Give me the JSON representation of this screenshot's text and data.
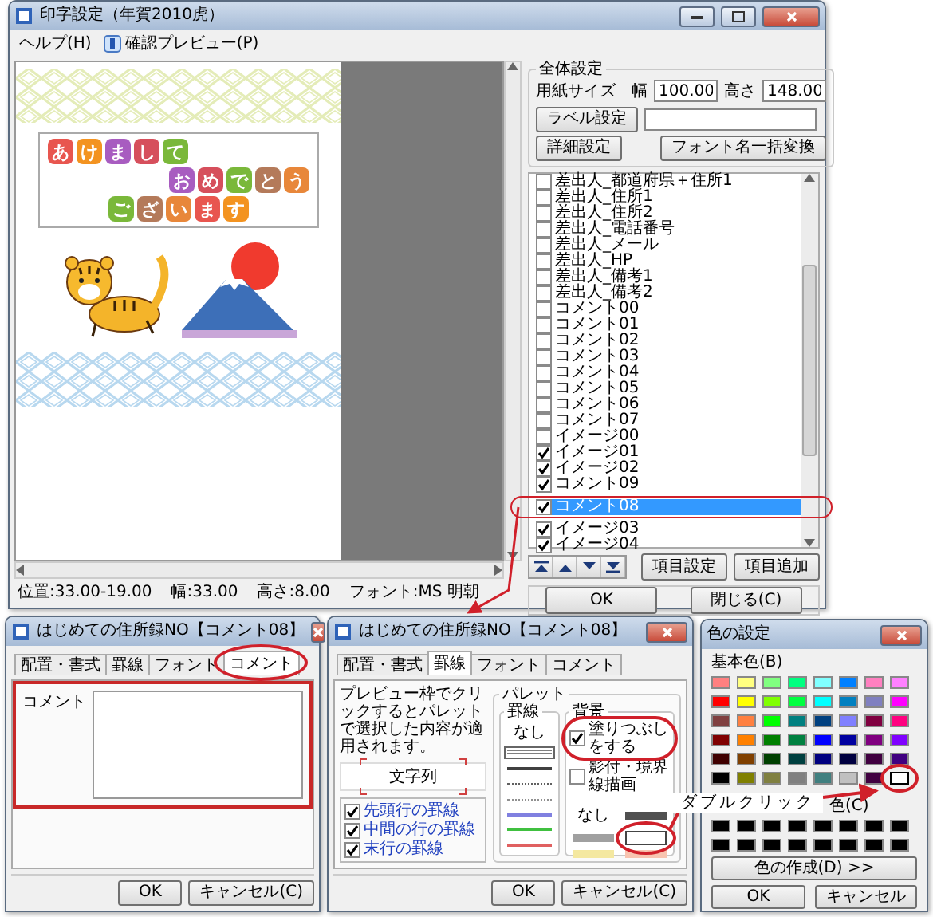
{
  "main_window": {
    "title": "印字設定（年賀2010虎）",
    "menu": [
      {
        "label": "ヘルプ(H)",
        "kind": "plain"
      },
      {
        "label": "確認プレビュー(P)",
        "kind": "icon"
      }
    ],
    "greeting_lines": [
      "あけまして",
      "おめでとう",
      "ございます"
    ],
    "status_bar": [
      "位置:33.00-19.00",
      "幅:33.00",
      "高さ:8.00",
      "フォント:MS 明朝"
    ],
    "settings": {
      "title": "全体設定",
      "paper_size_label": "用紙サイズ",
      "width_label": "幅",
      "width_value": "100.00",
      "height_label": "高さ",
      "height_value": "148.00",
      "label_button": "ラベル設定",
      "detail_button": "詳細設定",
      "font_button": "フォント名一括変換"
    },
    "items": [
      {
        "label": "差出人_都道府県＋住所1",
        "checked": false,
        "selected": false
      },
      {
        "label": "差出人_住所1",
        "checked": false,
        "selected": false
      },
      {
        "label": "差出人_住所2",
        "checked": false,
        "selected": false
      },
      {
        "label": "差出人_電話番号",
        "checked": false,
        "selected": false
      },
      {
        "label": "差出人_メール",
        "checked": false,
        "selected": false
      },
      {
        "label": "差出人_HP",
        "checked": false,
        "selected": false
      },
      {
        "label": "差出人_備考1",
        "checked": false,
        "selected": false
      },
      {
        "label": "差出人_備考2",
        "checked": false,
        "selected": false
      },
      {
        "label": "コメント00",
        "checked": false,
        "selected": false
      },
      {
        "label": "コメント01",
        "checked": false,
        "selected": false
      },
      {
        "label": "コメント02",
        "checked": false,
        "selected": false
      },
      {
        "label": "コメント03",
        "checked": false,
        "selected": false
      },
      {
        "label": "コメント04",
        "checked": false,
        "selected": false
      },
      {
        "label": "コメント05",
        "checked": false,
        "selected": false
      },
      {
        "label": "コメント06",
        "checked": false,
        "selected": false
      },
      {
        "label": "コメント07",
        "checked": false,
        "selected": false
      },
      {
        "label": "イメージ00",
        "checked": false,
        "selected": false
      },
      {
        "label": "イメージ01",
        "checked": true,
        "selected": false
      },
      {
        "label": "イメージ02",
        "checked": true,
        "selected": false
      },
      {
        "label": "コメント09",
        "checked": true,
        "selected": false
      },
      {
        "label": "コメント08",
        "checked": true,
        "selected": true
      },
      {
        "label": "イメージ03",
        "checked": true,
        "selected": false
      },
      {
        "label": "イメージ04",
        "checked": true,
        "selected": false
      }
    ],
    "order_buttons": [
      {
        "kind": "top"
      },
      {
        "kind": "up"
      },
      {
        "kind": "down"
      },
      {
        "kind": "bottom"
      }
    ],
    "item_buttons": [
      "項目設定",
      "項目追加"
    ],
    "footer_buttons": [
      "OK",
      "閉じる(C)"
    ]
  },
  "comment_dialog": {
    "title": "はじめての住所録NO【コメント08】",
    "tabs": [
      {
        "label": "配置・書式",
        "selected": false
      },
      {
        "label": "罫線",
        "selected": false
      },
      {
        "label": "フォント",
        "selected": false
      },
      {
        "label": "コメント",
        "selected": true
      }
    ],
    "comment_label": "コメント",
    "buttons": [
      "OK",
      "キャンセル(C)"
    ]
  },
  "border_dialog": {
    "title": "はじめての住所録NO【コメント08】",
    "tabs": [
      {
        "label": "配置・書式",
        "selected": false
      },
      {
        "label": "罫線",
        "selected": true
      },
      {
        "label": "フォント",
        "selected": false
      },
      {
        "label": "コメント",
        "selected": false
      }
    ],
    "instruction": "プレビュー枠でクリックするとパレットで選択した内容が適用されます。",
    "preview_text": "文字列",
    "line_options": [
      {
        "label": "先頭行の罫線",
        "checked": true
      },
      {
        "label": "中間の行の罫線",
        "checked": true
      },
      {
        "label": "末行の罫線",
        "checked": true
      }
    ],
    "palette_title": "パレット",
    "border_group": {
      "title": "罫線",
      "none_label": "なし",
      "lines": [
        {
          "kind": "double",
          "color": "#808080",
          "selected": true
        },
        {
          "kind": "solid",
          "color": "#404040",
          "selected": false
        },
        {
          "kind": "dotted",
          "color": "#606060",
          "selected": false
        },
        {
          "kind": "dotted",
          "color": "#909090",
          "selected": false
        },
        {
          "kind": "solid",
          "color": "#8080e0",
          "selected": false
        },
        {
          "kind": "solid",
          "color": "#40c040",
          "selected": false
        },
        {
          "kind": "solid",
          "color": "#e06060",
          "selected": false
        }
      ]
    },
    "background_group": {
      "title": "背景",
      "options": [
        {
          "label": "塗りつぶしをする",
          "checked": true
        },
        {
          "label": "影付・境界線描画",
          "checked": false
        }
      ],
      "none_label": "なし",
      "swatches": [
        {
          "color": "#505050",
          "selected": false
        },
        {
          "color": "#a0a0a0",
          "selected": false
        },
        {
          "color": "#ffffff",
          "selected": true
        },
        {
          "color": "#f4e8a0",
          "selected": false
        },
        {
          "color": "#f8c4b0",
          "selected": false
        }
      ]
    },
    "buttons": [
      "OK",
      "キャンセル(C)"
    ]
  },
  "callout": "ダブルクリック",
  "color_dialog": {
    "title": "色の設定",
    "basic_label": "基本色(B)",
    "basic_colors": [
      {
        "color": "#ff8080",
        "selected": false
      },
      {
        "color": "#ffff80",
        "selected": false
      },
      {
        "color": "#80ff80",
        "selected": false
      },
      {
        "color": "#00ff80",
        "selected": false
      },
      {
        "color": "#80ffff",
        "selected": false
      },
      {
        "color": "#0080ff",
        "selected": false
      },
      {
        "color": "#ff80c0",
        "selected": false
      },
      {
        "color": "#ff80ff",
        "selected": false
      },
      {
        "color": "#ff0000",
        "selected": false
      },
      {
        "color": "#ffff00",
        "selected": false
      },
      {
        "color": "#80ff00",
        "selected": false
      },
      {
        "color": "#00ff40",
        "selected": false
      },
      {
        "color": "#00ffff",
        "selected": false
      },
      {
        "color": "#0080c0",
        "selected": false
      },
      {
        "color": "#8080c0",
        "selected": false
      },
      {
        "color": "#ff00ff",
        "selected": false
      },
      {
        "color": "#804040",
        "selected": false
      },
      {
        "color": "#ff8040",
        "selected": false
      },
      {
        "color": "#00ff00",
        "selected": false
      },
      {
        "color": "#008080",
        "selected": false
      },
      {
        "color": "#004080",
        "selected": false
      },
      {
        "color": "#8080ff",
        "selected": false
      },
      {
        "color": "#800040",
        "selected": false
      },
      {
        "color": "#ff0080",
        "selected": false
      },
      {
        "color": "#800000",
        "selected": false
      },
      {
        "color": "#ff8000",
        "selected": false
      },
      {
        "color": "#008000",
        "selected": false
      },
      {
        "color": "#008040",
        "selected": false
      },
      {
        "color": "#0000ff",
        "selected": false
      },
      {
        "color": "#0000a0",
        "selected": false
      },
      {
        "color": "#800080",
        "selected": false
      },
      {
        "color": "#8000ff",
        "selected": false
      },
      {
        "color": "#400000",
        "selected": false
      },
      {
        "color": "#804000",
        "selected": false
      },
      {
        "color": "#004000",
        "selected": false
      },
      {
        "color": "#004040",
        "selected": false
      },
      {
        "color": "#000080",
        "selected": false
      },
      {
        "color": "#000040",
        "selected": false
      },
      {
        "color": "#400040",
        "selected": false
      },
      {
        "color": "#400080",
        "selected": false
      },
      {
        "color": "#000000",
        "selected": false
      },
      {
        "color": "#808000",
        "selected": false
      },
      {
        "color": "#808040",
        "selected": false
      },
      {
        "color": "#808080",
        "selected": false
      },
      {
        "color": "#408080",
        "selected": false
      },
      {
        "color": "#c0c0c0",
        "selected": false
      },
      {
        "color": "#400040",
        "selected": false
      },
      {
        "color": "#ffffff",
        "selected": true
      }
    ],
    "custom_label": "色(C)",
    "custom_colors": [
      {
        "color": "#000000"
      },
      {
        "color": "#000000"
      },
      {
        "color": "#000000"
      },
      {
        "color": "#000000"
      },
      {
        "color": "#000000"
      },
      {
        "color": "#000000"
      },
      {
        "color": "#000000"
      },
      {
        "color": "#000000"
      },
      {
        "color": "#000000"
      },
      {
        "color": "#000000"
      },
      {
        "color": "#000000"
      },
      {
        "color": "#000000"
      },
      {
        "color": "#000000"
      },
      {
        "color": "#000000"
      },
      {
        "color": "#000000"
      },
      {
        "color": "#000000"
      }
    ],
    "define_button": "色の作成(D) >>",
    "buttons": [
      "OK",
      "キャンセル"
    ]
  }
}
